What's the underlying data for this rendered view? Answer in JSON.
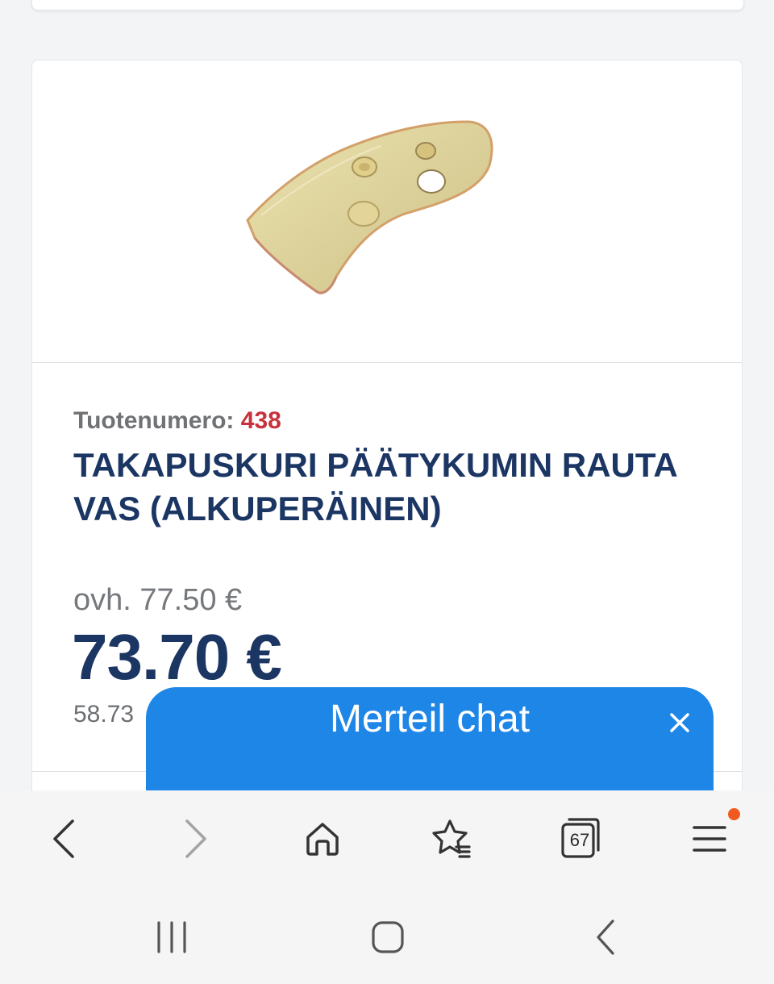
{
  "product": {
    "image_alt": "product-photo",
    "sku_label": "Tuotenumero:",
    "sku_value": "438",
    "title": "TAKAPUSKURI PÄÄTYKUMIN RAUTA VAS (ALKUPERÄINEN)",
    "old_price": "ovh. 77.50 €",
    "price": "73.70 €",
    "net_price_partial": "58.73"
  },
  "chat": {
    "title": "Merteil chat",
    "close_symbol": "×"
  },
  "browser_toolbar": {
    "tab_count": "67",
    "icons": [
      "back-icon",
      "forward-icon",
      "home-icon",
      "bookmarks-icon",
      "tabs-icon",
      "menu-icon"
    ],
    "notification_color": "#f05a1e"
  },
  "system_nav": {
    "icons": [
      "recent-apps-icon",
      "home-circle-icon",
      "system-back-icon"
    ]
  },
  "colors": {
    "title_navy": "#1c3664",
    "sku_red": "#c8323c",
    "chat_blue": "#1e86e6"
  }
}
